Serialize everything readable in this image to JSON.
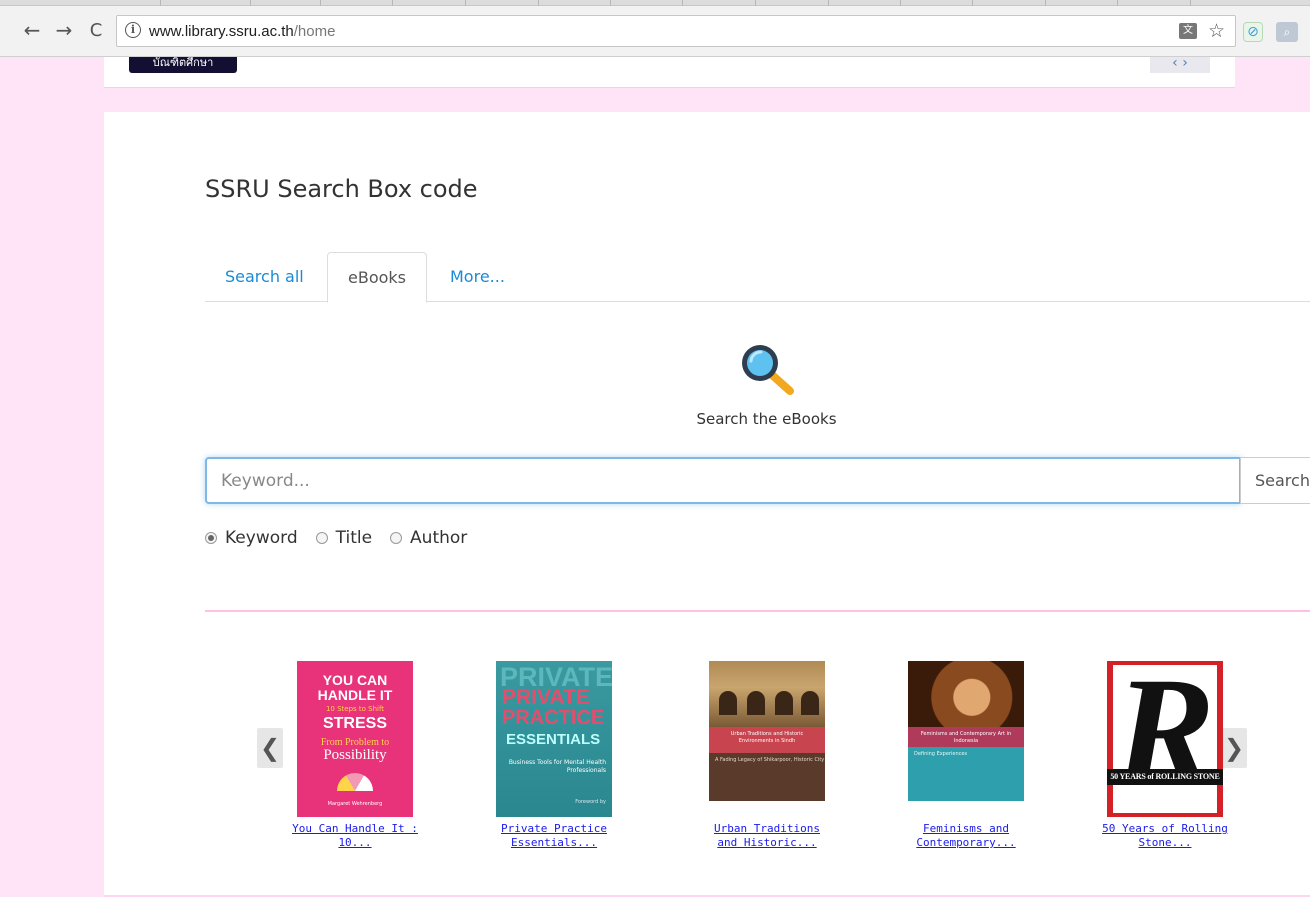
{
  "browser": {
    "url_host": "www.library.ssru.ac.th",
    "url_path": "/home",
    "nav": {
      "back": "←",
      "forward": "→",
      "reload": "C"
    }
  },
  "top_card": {
    "logo_text": "บัณฑิตศึกษา",
    "arrows": "‹ ›"
  },
  "main": {
    "heading": "SSRU Search Box code",
    "tabs": [
      {
        "label": "Search all"
      },
      {
        "label": "eBooks"
      },
      {
        "label": "More..."
      }
    ],
    "search_caption": "Search the eBooks",
    "search": {
      "placeholder": "Keyword...",
      "button_label": "Search"
    },
    "radio_options": [
      {
        "label": "Keyword",
        "checked": true
      },
      {
        "label": "Title",
        "checked": false
      },
      {
        "label": "Author",
        "checked": false
      }
    ]
  },
  "carousel": {
    "prev": "❮",
    "next": "❯",
    "books": [
      {
        "title_line1": "You Can Handle It :",
        "title_line2": "10...",
        "cover_text": [
          "YOU CAN",
          "HANDLE IT",
          "10 Steps to Shift",
          "STRESS",
          "From Problem to",
          "Possibility",
          "Margaret Wehrenberg"
        ]
      },
      {
        "title_line1": "Private Practice",
        "title_line2": "Essentials...",
        "cover_text": [
          "PRIVATE",
          "PRIVATE",
          "PRACTICE",
          "ESSENTIALS",
          "Business Tools for Mental Health Professionals",
          "Foreword by"
        ]
      },
      {
        "title_line1": "Urban Traditions",
        "title_line2": "and Historic...",
        "cover_text": [
          "Urban Traditions and Historic Environments in Sindh",
          "A Fading Legacy of Shikarpoor, Historic City"
        ]
      },
      {
        "title_line1": "Feminisms and",
        "title_line2": "Contemporary...",
        "cover_text": [
          "Feminisms and Contemporary Art in Indonesia",
          "Defining Experiences"
        ]
      },
      {
        "title_line1": "50 Years of Rolling",
        "title_line2": "Stone...",
        "cover_text": [
          "R",
          "50 YEARS of ROLLING STONE"
        ]
      }
    ]
  }
}
